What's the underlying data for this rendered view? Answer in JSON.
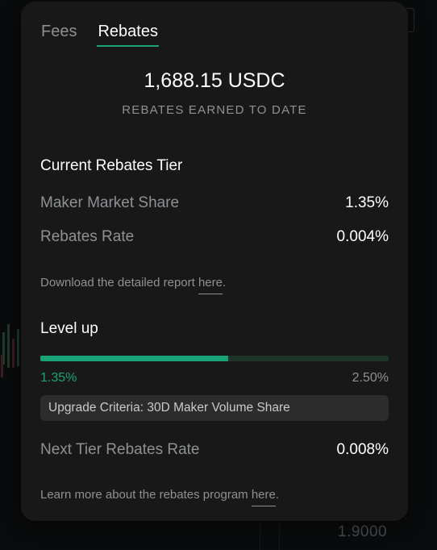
{
  "tabs": [
    {
      "label": "Fees",
      "active": false
    },
    {
      "label": "Rebates",
      "active": true
    }
  ],
  "summary": {
    "amount": "1,688.15 USDC",
    "caption": "REBATES EARNED TO DATE"
  },
  "current_tier": {
    "title": "Current Rebates Tier",
    "rows": [
      {
        "label": "Maker Market Share",
        "value": "1.35%"
      },
      {
        "label": "Rebates Rate",
        "value": "0.004%"
      }
    ],
    "report_note": "Download the detailed report ",
    "report_link": "here",
    "report_suffix": "."
  },
  "level_up": {
    "title": "Level up",
    "progress_fraction": 0.54,
    "current_label": "1.35%",
    "target_label": "2.50%",
    "criteria": "Upgrade Criteria: 30D Maker Volume Share",
    "next_rate_label": "Next Tier Rebates Rate",
    "next_rate_value": "0.008%",
    "learn_note": "Learn more about the rebates program ",
    "learn_link": "here",
    "learn_suffix": "."
  },
  "background": {
    "price": "1.9000"
  },
  "colors": {
    "accent": "#1aa277",
    "panel": "#181818",
    "muted_text": "#8e9194"
  }
}
